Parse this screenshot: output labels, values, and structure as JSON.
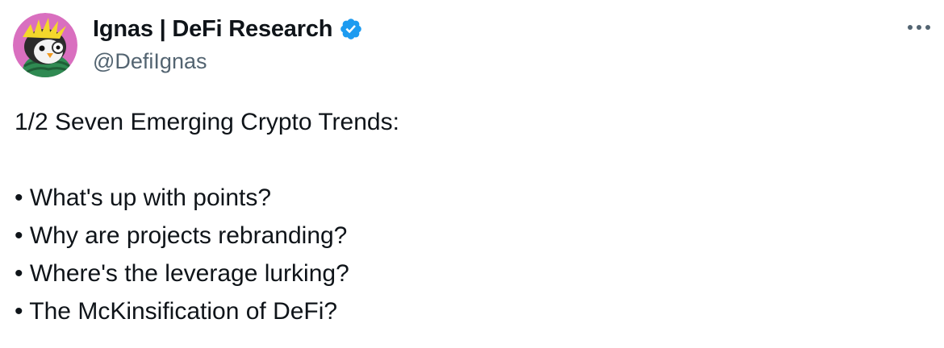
{
  "author": {
    "display_name": "Ignas | DeFi Research",
    "handle": "@DefiIgnas",
    "verified": true,
    "avatar_icon": "penguin-avatar-icon",
    "verified_icon": "verified-badge-icon"
  },
  "colors": {
    "text_primary": "#0f1419",
    "text_secondary": "#536471",
    "verified_blue": "#1d9bf0",
    "avatar_background": "#d96fbf",
    "scarf_green": "#2e7d4a"
  },
  "tweet": {
    "intro": "1/2 Seven Emerging Crypto Trends:",
    "bullets": [
      "• What's up with points?",
      "• Why are projects rebranding?",
      "• Where's the leverage lurking?",
      "• The McKinsification of DeFi?"
    ]
  },
  "menu": {
    "more_icon": "more-options-icon"
  }
}
